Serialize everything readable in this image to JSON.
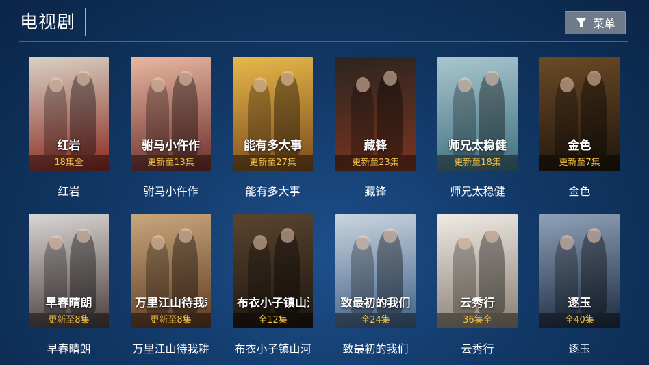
{
  "header": {
    "title": "电视剧",
    "menu_label": "菜单"
  },
  "colors": {
    "badge_text": "#f5c242",
    "background": "#123968"
  },
  "items": [
    {
      "name": "红岩",
      "badge": "18集全",
      "poster_title": "红岩",
      "bg": [
        "#d9d2c4",
        "#8a2a22"
      ]
    },
    {
      "name": "驸马小仵作",
      "badge": "更新至13集",
      "poster_title": "驸马小仵作",
      "bg": [
        "#e9b7a2",
        "#6b2f2a"
      ]
    },
    {
      "name": "能有多大事",
      "badge": "更新至27集",
      "poster_title": "能有多大事",
      "bg": [
        "#e8b84a",
        "#7a4a1c"
      ]
    },
    {
      "name": "藏锋",
      "badge": "更新至23集",
      "poster_title": "藏锋",
      "bg": [
        "#2b2520",
        "#7a3520"
      ]
    },
    {
      "name": "师兄太稳健",
      "badge": "更新至18集",
      "poster_title": "师兄太稳健",
      "bg": [
        "#a9c6cf",
        "#3f6f7e"
      ]
    },
    {
      "name": "金色",
      "badge": "更新至7集",
      "poster_title": "金色",
      "bg": [
        "#6b4a26",
        "#1f150c"
      ]
    },
    {
      "name": "早春晴朗",
      "badge": "更新至8集",
      "poster_title": "早春晴朗",
      "bg": [
        "#d8d6d4",
        "#4a3c3e"
      ]
    },
    {
      "name": "万里江山待我耕",
      "badge": "更新至8集",
      "poster_title": "万里江山待我耕",
      "bg": [
        "#c8a77c",
        "#5e3a22"
      ]
    },
    {
      "name": "布衣小子镇山河",
      "badge": "全12集",
      "poster_title": "布衣小子镇山河",
      "bg": [
        "#5a4430",
        "#1c150e"
      ]
    },
    {
      "name": "致最初的我们",
      "badge": "全24集",
      "poster_title": "致最初的我们",
      "bg": [
        "#c9d5df",
        "#3f5f86"
      ]
    },
    {
      "name": "云秀行",
      "badge": "36集全",
      "poster_title": "云秀行",
      "bg": [
        "#eeeae4",
        "#8a7d72"
      ]
    },
    {
      "name": "逐玉",
      "badge": "全40集",
      "poster_title": "逐玉",
      "bg": [
        "#8fa1b8",
        "#1c2a3f"
      ]
    }
  ]
}
